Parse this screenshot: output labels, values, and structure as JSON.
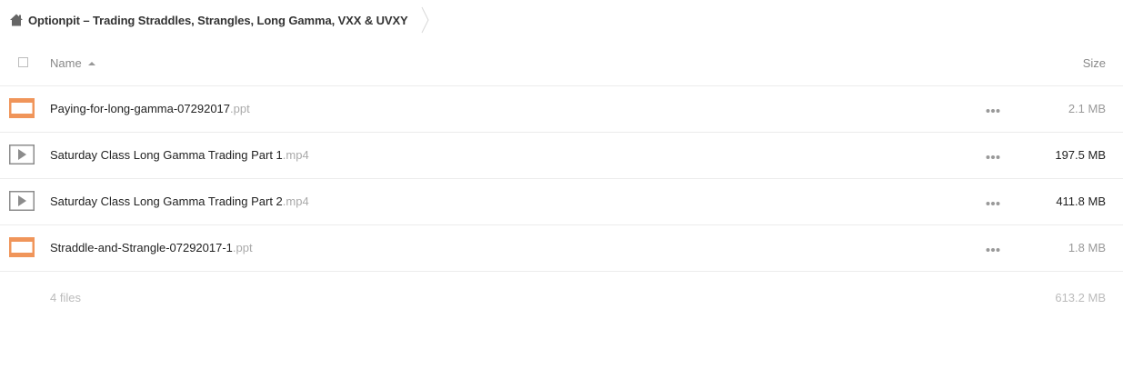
{
  "breadcrumb": {
    "title": "Optionpit – Trading Straddles, Strangles, Long Gamma, VXX & UVXY",
    "icon": "home-icon"
  },
  "header": {
    "name_label": "Name",
    "size_label": "Size",
    "sort": "ascending"
  },
  "files": [
    {
      "name": "Paying-for-long-gamma-07292017",
      "ext": ".ppt",
      "size": "2.1 MB",
      "type": "presentation",
      "size_color": "#999999"
    },
    {
      "name": "Saturday Class Long Gamma Trading Part 1",
      "ext": ".mp4",
      "size": "197.5 MB",
      "type": "video",
      "size_color": "#222222"
    },
    {
      "name": "Saturday Class Long Gamma Trading Part 2",
      "ext": ".mp4",
      "size": "411.8 MB",
      "type": "video",
      "size_color": "#222222"
    },
    {
      "name": "Straddle-and-Strangle-07292017-1",
      "ext": ".ppt",
      "size": "1.8 MB",
      "type": "presentation",
      "size_color": "#999999"
    }
  ],
  "footer": {
    "file_count": "4 files",
    "total_size": "613.2 MB"
  },
  "colors": {
    "presentation_icon": "#f0955a",
    "video_icon": "#8c8c8c"
  }
}
